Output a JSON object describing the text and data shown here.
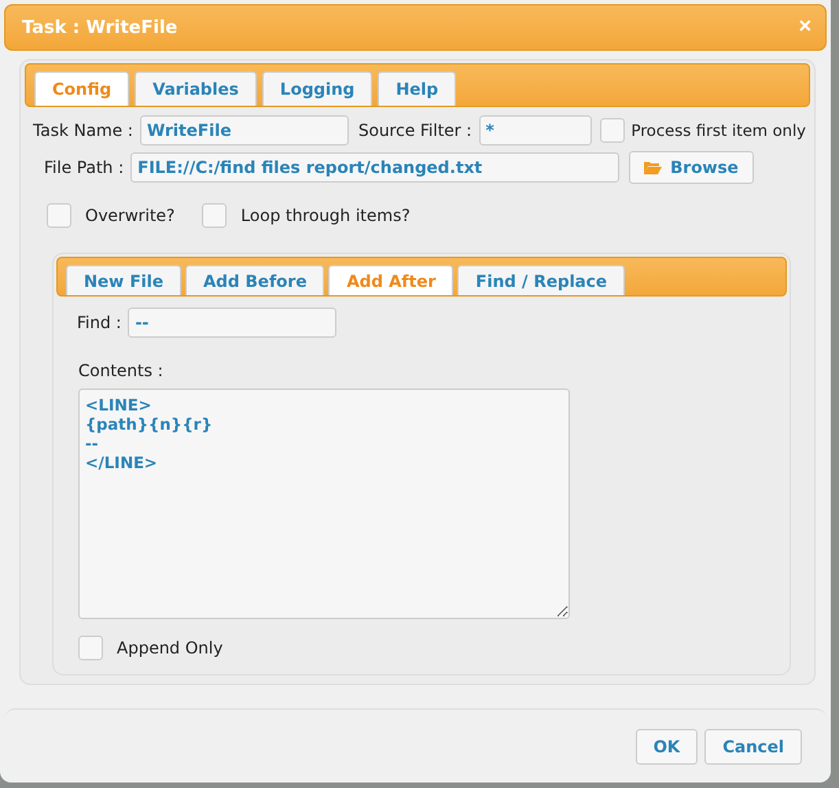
{
  "dialog": {
    "title": "Task : WriteFile",
    "close": "×"
  },
  "tabs": [
    {
      "label": "Config",
      "selected": true
    },
    {
      "label": "Variables",
      "selected": false
    },
    {
      "label": "Logging",
      "selected": false
    },
    {
      "label": "Help",
      "selected": false
    }
  ],
  "task_name": {
    "label": "Task Name :",
    "value": "WriteFile"
  },
  "source_filter": {
    "label": "Source Filter :",
    "value": "*"
  },
  "process_first": {
    "label": "Process first item only",
    "checked": false
  },
  "file_path": {
    "label": "File Path :",
    "value": "FILE://C:/find files report/changed.txt"
  },
  "browse": {
    "label": "Browse"
  },
  "options": [
    {
      "label": "Overwrite?",
      "checked": false
    },
    {
      "label": "Loop through items?",
      "checked": false
    }
  ],
  "mode_tabs": [
    {
      "label": "New File",
      "selected": false
    },
    {
      "label": "Add Before",
      "selected": false
    },
    {
      "label": "Add After",
      "selected": true
    },
    {
      "label": "Find / Replace",
      "selected": false
    }
  ],
  "find": {
    "label": "Find :",
    "value": "--"
  },
  "contents": {
    "label": "Contents :",
    "value": "<LINE>\n{path}{n}{r}\n--\n</LINE>"
  },
  "append_only": {
    "label": "Append Only",
    "checked": false
  },
  "buttons": [
    "OK",
    "Cancel"
  ]
}
